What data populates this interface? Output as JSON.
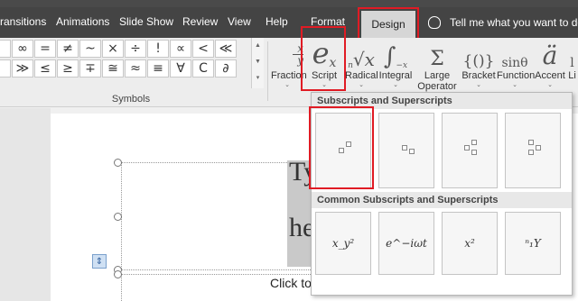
{
  "tabs": [
    {
      "label": "ransitions"
    },
    {
      "label": "Animations"
    },
    {
      "label": "Slide Show"
    },
    {
      "label": "Review"
    },
    {
      "label": "View"
    },
    {
      "label": "Help"
    },
    {
      "label": "Format"
    },
    {
      "label": "Design"
    }
  ],
  "tell_me": "Tell me what you want to do",
  "symbols": {
    "row1": [
      "",
      "∞",
      "=",
      "≠",
      "~",
      "×",
      "÷",
      "!",
      "∝",
      "<",
      "≪"
    ],
    "row2": [
      "",
      "≫",
      "≤",
      "≥",
      "∓",
      "≅",
      "≈",
      "≡",
      "∀",
      "C",
      "∂"
    ],
    "row3": [
      "",
      "",
      "",
      "",
      "",
      "",
      "",
      "",
      "",
      "",
      ""
    ],
    "group_label": "Symbols"
  },
  "structures": [
    {
      "label": "Fraction",
      "glyph": "x/y"
    },
    {
      "label": "Script",
      "glyph": "eˣ"
    },
    {
      "label": "Radical",
      "glyph": "ⁿ√x"
    },
    {
      "label": "Integral",
      "glyph": "∫"
    },
    {
      "label": "Large",
      "label2": "Operator",
      "glyph": "Σ"
    },
    {
      "label": "Bracket",
      "glyph": "{()}"
    },
    {
      "label": "Function",
      "glyph": "sinθ"
    },
    {
      "label": "Accent",
      "glyph": "ä"
    },
    {
      "label": "Li",
      "glyph": ""
    }
  ],
  "dropdown": {
    "section1": "Subscripts and Superscripts",
    "section2": "Common Subscripts and Superscripts",
    "common": [
      "x_y²",
      "e^−iωt",
      "x²",
      "ⁿ₁Y"
    ]
  },
  "document": {
    "line1": "Ty",
    "line2": "he",
    "click": "Click to"
  },
  "colors": {
    "highlight": "#e01b24",
    "tabbar": "#444444",
    "ribbon": "#ededed"
  }
}
